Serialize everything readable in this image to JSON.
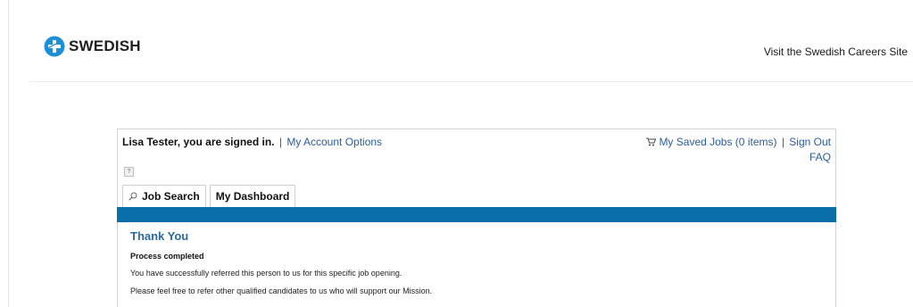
{
  "header": {
    "logo_text": "SWEDISH",
    "careers_link": "Visit the Swedish Careers Site"
  },
  "account": {
    "signed_in_text": "Lisa Tester, you are signed in.",
    "separator": "|",
    "account_options": "My Account Options",
    "saved_jobs": "My Saved Jobs (0 items)",
    "sign_out": "Sign Out",
    "faq": "FAQ",
    "help": "?"
  },
  "tabs": [
    {
      "label": "Job Search",
      "icon": "search-icon"
    },
    {
      "label": "My Dashboard"
    }
  ],
  "content": {
    "title": "Thank You",
    "status": "Process completed",
    "message_1": "You have successfully referred this person to us for this specific job opening.",
    "message_2": "Please feel free to refer other qualified candidates to us who will support our Mission."
  },
  "colors": {
    "brand_blue": "#0a6ea9",
    "link_blue": "#2a5d9b",
    "title_blue": "#2b6aa0",
    "logo_blue": "#1c8fd6"
  }
}
